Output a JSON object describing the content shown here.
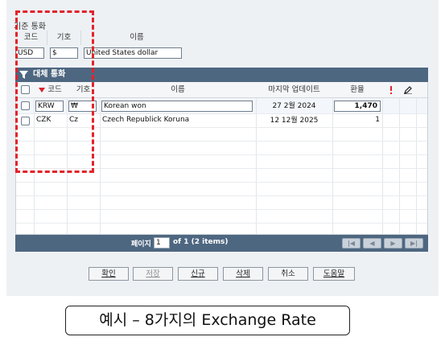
{
  "base_currency": {
    "section_title": "기준 통화",
    "headers": {
      "code": "코드",
      "symbol": "기호",
      "name": "이름"
    },
    "code": "USD",
    "symbol": "$",
    "name": "United States dollar"
  },
  "alt_currency": {
    "title": "대체 통화",
    "headers": {
      "code": "코드",
      "symbol": "기호",
      "name": "이름",
      "last_update": "마지막 업데이트",
      "rate": "환율"
    },
    "rows": [
      {
        "code": "KRW",
        "symbol": "₩",
        "name": "Korean won",
        "last_update": "27 2월 2024",
        "rate": "1,470"
      },
      {
        "code": "CZK",
        "symbol": "Cz",
        "name": "Czech Republick Koruna",
        "last_update": "12 12월 2025",
        "rate": "1"
      }
    ]
  },
  "pager": {
    "page_label": "페이지",
    "page_value": "1",
    "of_text": "of 1  (2 items)"
  },
  "buttons": {
    "ok": "확인",
    "save": "저장",
    "new": "신규",
    "delete": "삭제",
    "cancel": "취소",
    "help": "도움말"
  },
  "caption": "예시 – 8가지의 Exchange Rate",
  "colors": {
    "header_bar": "#4e6781",
    "panel_bg": "#eef1f4",
    "annotation_red": "#e2232a",
    "sort_arrow": "#d9232b"
  },
  "icons": [
    "filter-icon",
    "sort-desc-icon",
    "exclamation-icon",
    "pencil-icon",
    "first-page-icon",
    "prev-page-icon",
    "next-page-icon",
    "last-page-icon"
  ]
}
